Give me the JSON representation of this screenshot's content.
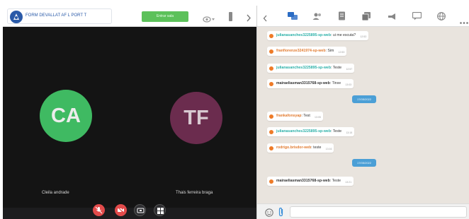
{
  "meeting": {
    "room_name": "FORM DEVALLAT AF L PORT T",
    "enter_button_label": "Entrar sala",
    "participants": [
      {
        "initials": "CA",
        "name": "Cleila andrade",
        "color": "#3fba62"
      },
      {
        "initials": "TF",
        "name": "Thais ferreira braga",
        "color": "#6b2c4e"
      }
    ],
    "controls": [
      {
        "name": "mic-button",
        "icon": "mic-muted-icon"
      },
      {
        "name": "camera-button",
        "icon": "camera-off-icon"
      },
      {
        "name": "screen-button",
        "icon": "screen-share-icon"
      },
      {
        "name": "apps-button",
        "icon": "grid-icon"
      }
    ]
  },
  "chat": {
    "toolbar_icons": [
      "back-icon",
      "chat-icon",
      "people-icon",
      "document-icon",
      "copy-icon",
      "megaphone-icon",
      "message-icon",
      "globe-icon",
      "more-icon"
    ],
    "messages": [
      {
        "sender": "julianasanches3225895-sp-web",
        "text": "ui me escuta?",
        "time": "12:53"
      },
      {
        "sender": "franfiorenze3241974-sp-web",
        "text": "Sim",
        "time": "12:53"
      },
      {
        "sender": "julianasanches3225895-sp-web",
        "text": "Teste",
        "time": "12:57"
      },
      {
        "sender": "mairaeliasman3315768-sp-web",
        "text": "Tinxe",
        "time": "13:03"
      },
      {
        "sender": "frankafonsyap",
        "text": "Test",
        "time": "13:05"
      },
      {
        "sender": "julianasanches3225895-sp-web",
        "text": "Teste",
        "time": "13:15"
      },
      {
        "sender": "rodrigo.brisdor-web",
        "text": "teste",
        "time": "13:16"
      },
      {
        "sender": "mairaeliasman3315768-sp-web",
        "text": "Teste",
        "time": "13:21"
      }
    ],
    "date_separators": [
      "17/05/2022",
      "17/05/2022"
    ],
    "input_placeholder": ""
  },
  "colors": {
    "accent_blue": "#2a5aa8",
    "enter_green": "#5cc15a",
    "danger_red": "#e24b4b",
    "chat_bg": "#e9e4de",
    "date_pill": "#4b9fd6"
  }
}
